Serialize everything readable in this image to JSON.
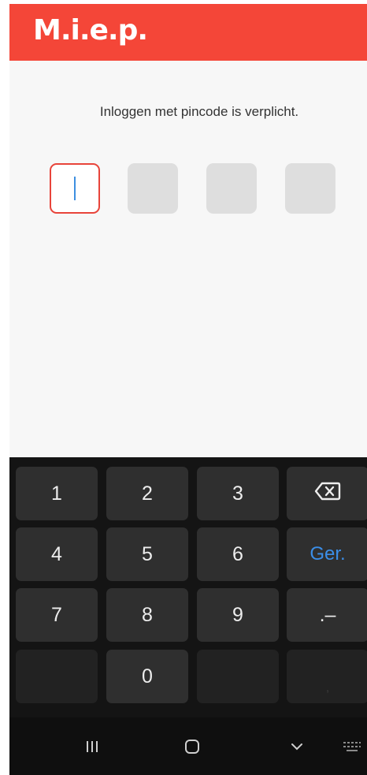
{
  "app": {
    "logo_text": "M.i.e.p.",
    "brand_color": "#f44638"
  },
  "login": {
    "message": "Inloggen met pincode is verplicht.",
    "pin_length": 4,
    "pin_digits": [
      "",
      "",
      "",
      ""
    ]
  },
  "keyboard": {
    "keys": {
      "k1": "1",
      "k2": "2",
      "k3": "3",
      "k4": "4",
      "k5": "5",
      "k6": "6",
      "k7": "7",
      "k8": "8",
      "k9": "9",
      "k0": "0",
      "action": "Ger.",
      "symbols": ".–",
      "comma": ","
    },
    "backspace_icon": "backspace-icon",
    "accent_color": "#3b8ee8"
  },
  "navbar": {
    "icons": [
      "recent-apps-icon",
      "home-icon",
      "back-down-icon",
      "keyboard-icon"
    ]
  }
}
